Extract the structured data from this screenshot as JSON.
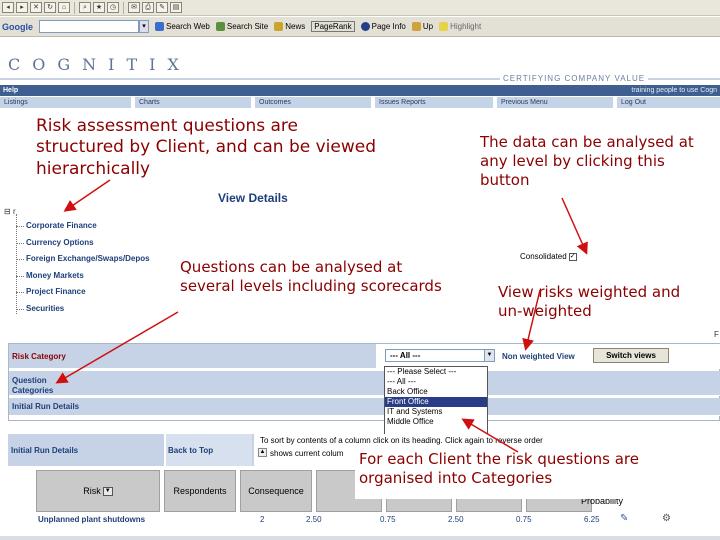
{
  "browser": {
    "google_label": "Google",
    "buttons": [
      "Search Web",
      "Search Site",
      "News",
      "PageRank",
      "Page Info",
      "Up",
      "Highlight"
    ]
  },
  "banner": {
    "logo": "COGNITIX",
    "tagline": "CERTIFYING COMPANY VALUE",
    "help": "Help",
    "help_right": "training people to use Cogn"
  },
  "nav": [
    "Listings",
    "Charts",
    "Outcomes",
    "Issues Reports",
    "Previous Menu",
    "Log Out"
  ],
  "notes": {
    "risk": "Risk assessment questions are structured by Client, and can be viewed hierarchically",
    "data": "The data can be analysed at any level by clicking this button",
    "levels": "Questions can be analysed at several levels including scorecards",
    "weight": "View risks weighted and un-weighted",
    "categories": "For each Client the risk questions are organised into Categories"
  },
  "tree": {
    "title": "View Details",
    "root": "r",
    "items": [
      "Corporate Finance",
      "Currency Options",
      "Foreign Exchange/Swaps/Depos",
      "Money Markets",
      "Project Finance",
      "Securities"
    ]
  },
  "consolidated": {
    "label": "Consolidated",
    "checked": true
  },
  "risk_panel": {
    "risk_category": "Risk Category",
    "question_categories": "Question Categories",
    "initial_run": "Initial Run Details",
    "select_value": "--- All ---",
    "nonweighted": "Non weighted View",
    "switch": "Switch views",
    "options": [
      "--- Please Select ---",
      "--- All ---",
      "Back Office",
      "Front Office",
      "IT and Systems",
      "Middle Office"
    ],
    "selected_option": "Front Office"
  },
  "lower": {
    "initial_run": "Initial Run Details",
    "back_to_top": "Back to Top",
    "instr1": "To sort by contents of a column click on its heading. Click again to reverse order",
    "instr2": "shows current colum"
  },
  "table": {
    "headers": [
      "Risk",
      "Respondents",
      "Consequence",
      "",
      "",
      "",
      ""
    ],
    "probability": "Probability",
    "row": {
      "name": "Unplanned plant shutdowns",
      "values": [
        "2",
        "2.50",
        "0.75",
        "2.50",
        "0.75",
        "6.25"
      ]
    }
  },
  "stray": "F"
}
